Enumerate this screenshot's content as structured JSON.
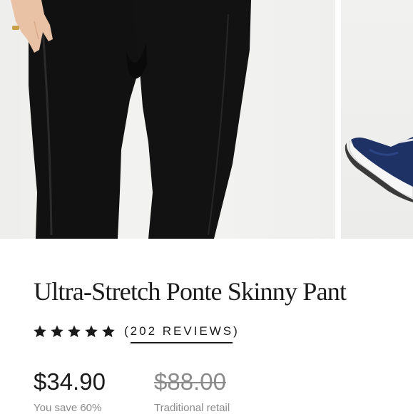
{
  "product": {
    "title": "Ultra-Stretch Ponte Skinny Pant",
    "rating": {
      "stars": 5,
      "max": 5,
      "reviews_label": "(202 REVIEWS)"
    },
    "price": {
      "value": "$34.90",
      "note": "You save 60%"
    },
    "retail": {
      "value": "$88.00",
      "note": "Traditional retail"
    }
  },
  "colors": {
    "star": "#1a1a1a",
    "text": "#1a1a1a",
    "muted": "#8b8b8b",
    "pants": "#111111"
  },
  "icons": {
    "star": "star-icon"
  }
}
